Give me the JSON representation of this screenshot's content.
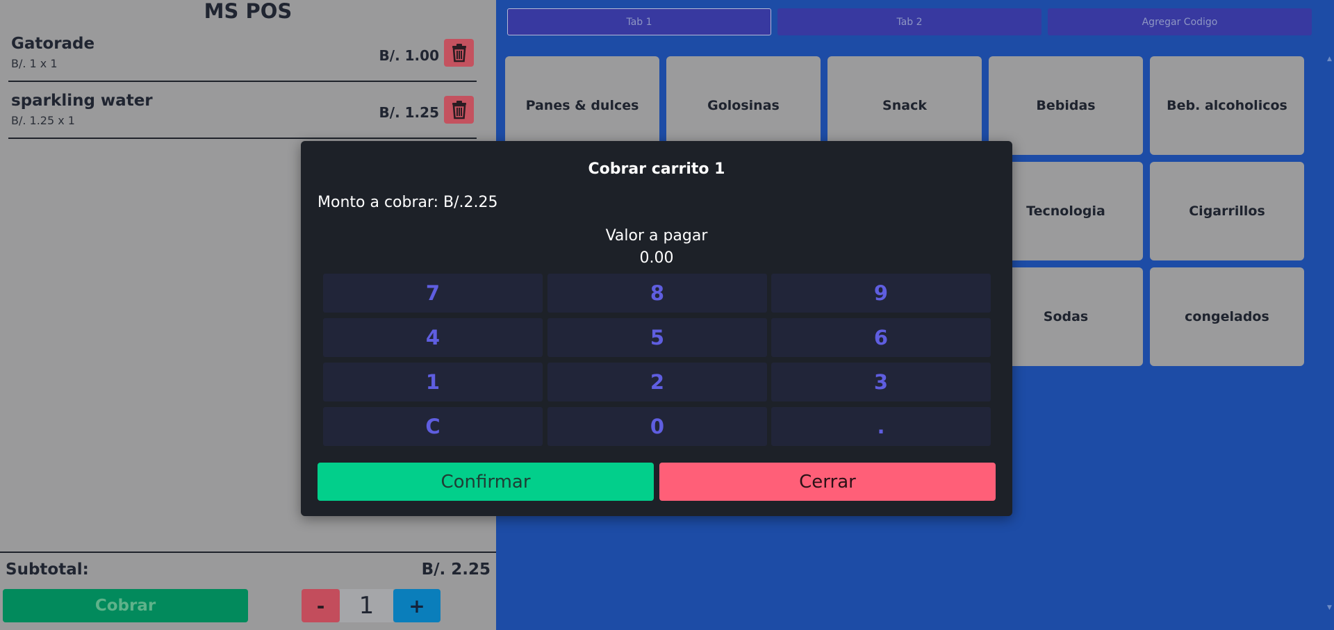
{
  "app": {
    "title": "MS POS"
  },
  "cart": {
    "items": [
      {
        "name": "Gatorade",
        "qty_line": "B/. 1 x 1",
        "price": "B/. 1.00",
        "icon": "trash-icon"
      },
      {
        "name": "sparkling water",
        "qty_line": "B/. 1.25 x 1",
        "price": "B/. 1.25",
        "icon": "trash-icon"
      }
    ],
    "subtotal_label": "Subtotal:",
    "subtotal_value": "B/. 2.25",
    "cobrar_label": "Cobrar",
    "minus_label": "-",
    "quantity": "1",
    "plus_label": "+"
  },
  "tabs": [
    {
      "label": "Tab 1",
      "active": true
    },
    {
      "label": "Tab 2",
      "active": false
    },
    {
      "label": "Agregar Codigo",
      "active": false
    }
  ],
  "categories": [
    "Panes & dulces",
    "Golosinas",
    "Snack",
    "Bebidas",
    "Beb. alcoholicos",
    "Tecnologia",
    "Cigarrillos",
    "Sodas",
    "congelados"
  ],
  "modal": {
    "title": "Cobrar carrito 1",
    "amount_text": "Monto a cobrar: B/.2.25",
    "pay_label": "Valor a pagar",
    "pay_value": "0.00",
    "keys": [
      "7",
      "8",
      "9",
      "4",
      "5",
      "6",
      "1",
      "2",
      "3",
      "C",
      "0",
      "."
    ],
    "confirm_label": "Confirmar",
    "close_label": "Cerrar"
  },
  "colors": {
    "background": "#1d4ca6",
    "overlay_panel": "#9a9a9b",
    "modal_bg": "#1d2128",
    "key_text": "#5f5ee0",
    "confirm": "#02cf8b",
    "close": "#ff5f78",
    "cobrar": "#028a5c",
    "delete": "#c4525f",
    "tab": "#3839a0"
  }
}
